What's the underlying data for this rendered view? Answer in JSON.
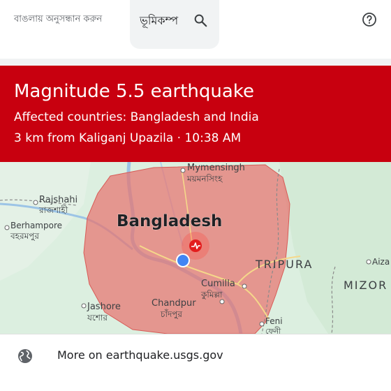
{
  "search": {
    "hint": "বাঙলায় অনুসন্ধান করুন",
    "query": "ভূমিকম্প"
  },
  "banner": {
    "title": "Magnitude 5.5 earthquake",
    "affected": "Affected countries: Bangladesh and India",
    "location_time": "3 km from Kaliganj Upazila · 10:38 AM",
    "color": "#c8000f"
  },
  "map": {
    "labels": {
      "mymensingh_en": "Mymensingh",
      "mymensingh_bn": "ময়মনসিংহ",
      "rajshahi_en": "Rajshahi",
      "rajshahi_bn": "রাজশাহী",
      "berhampore_en": "Berhampore",
      "berhampore_bn": "বহরমপুর",
      "bangladesh": "Bangladesh",
      "tripura": "TRIPURA",
      "aizawl": "Aiza",
      "mizoram": "MIZOR",
      "cumilla_en": "Cumilla",
      "cumilla_bn": "কুমিল্লা",
      "chandpur_en": "Chandpur",
      "chandpur_bn": "চাঁদপুর",
      "jashore_en": "Jashore",
      "jashore_bn": "যশোর",
      "feni_en": "Feni",
      "feni_bn": "ফেনী"
    },
    "icons": [
      "epicenter-marker-icon",
      "current-location-dot-icon"
    ],
    "affected_area_color": "#e8736f"
  },
  "footer": {
    "link_text": "More on earthquake.usgs.gov",
    "icon": "globe-icon"
  }
}
